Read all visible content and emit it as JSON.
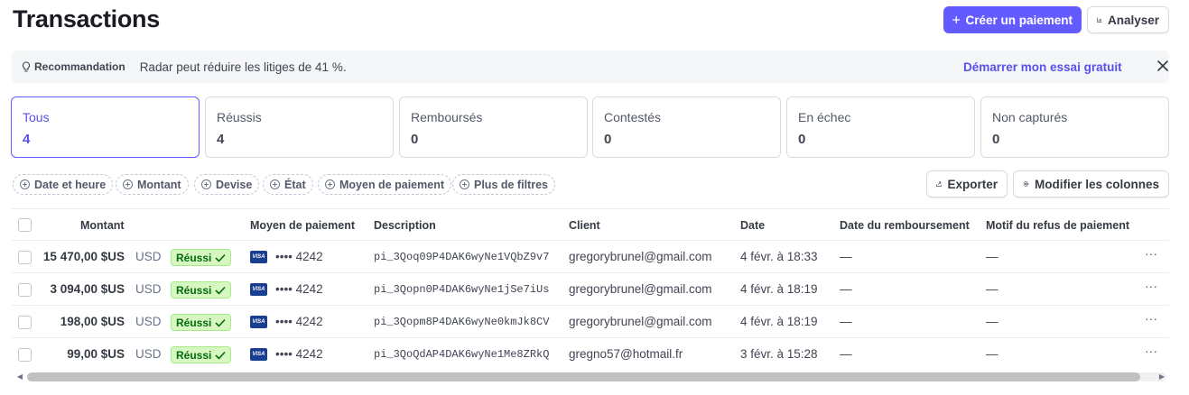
{
  "page": {
    "title": "Transactions"
  },
  "header": {
    "create_payment_label": "Créer un paiement",
    "analyse_label": "Analyser"
  },
  "banner": {
    "tag": "Recommandation",
    "message": "Radar peut réduire les litiges de 41 %.",
    "cta": "Démarrer mon essai gratuit"
  },
  "tabs": [
    {
      "label": "Tous",
      "count": "4"
    },
    {
      "label": "Réussis",
      "count": "4"
    },
    {
      "label": "Remboursés",
      "count": "0"
    },
    {
      "label": "Contestés",
      "count": "0"
    },
    {
      "label": "En échec",
      "count": "0"
    },
    {
      "label": "Non capturés",
      "count": "0"
    }
  ],
  "filters": [
    "Date et heure",
    "Montant",
    "Devise",
    "État",
    "Moyen de paiement",
    "Plus de filtres"
  ],
  "toolbar": {
    "export_label": "Exporter",
    "columns_label": "Modifier les colonnes"
  },
  "table": {
    "columns": [
      "Montant",
      "Moyen de paiement",
      "Description",
      "Client",
      "Date",
      "Date du remboursement",
      "Motif du refus de paiement"
    ],
    "rows": [
      {
        "amount": "15 470,00 $US",
        "currency": "USD",
        "status": "Réussi",
        "card_brand": "VISA",
        "card_last4": "•••• 4242",
        "description": "pi_3Qoq09P4DAK6wyNe1VQbZ9v7",
        "customer": "gregorybrunel@gmail.com",
        "date": "4 févr. à 18:33",
        "refund_date": "—",
        "dispute_reason": "—"
      },
      {
        "amount": "3 094,00 $US",
        "currency": "USD",
        "status": "Réussi",
        "card_brand": "VISA",
        "card_last4": "•••• 4242",
        "description": "pi_3Qopn0P4DAK6wyNe1jSe7iUs",
        "customer": "gregorybrunel@gmail.com",
        "date": "4 févr. à 18:19",
        "refund_date": "—",
        "dispute_reason": "—"
      },
      {
        "amount": "198,00 $US",
        "currency": "USD",
        "status": "Réussi",
        "card_brand": "VISA",
        "card_last4": "•••• 4242",
        "description": "pi_3Qopm8P4DAK6wyNe0kmJk8CV",
        "customer": "gregorybrunel@gmail.com",
        "date": "4 févr. à 18:19",
        "refund_date": "—",
        "dispute_reason": "—"
      },
      {
        "amount": "99,00 $US",
        "currency": "USD",
        "status": "Réussi",
        "card_brand": "VISA",
        "card_last4": "•••• 4242",
        "description": "pi_3QoQdAP4DAK6wyNe1Me8ZRkQ",
        "customer": "gregno57@hotmail.fr",
        "date": "3 févr. à 15:28",
        "refund_date": "—",
        "dispute_reason": "—"
      }
    ]
  },
  "colors": {
    "accent": "#635bff",
    "success_bg": "#d7f7c2",
    "success_text": "#05690d"
  }
}
